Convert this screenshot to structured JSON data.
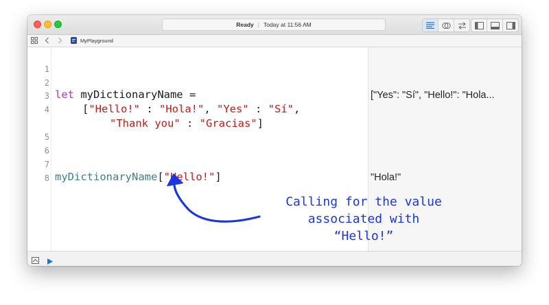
{
  "titlebar": {
    "status_label": "Ready",
    "timestamp": "Today at 11:56 AM"
  },
  "jumpbar": {
    "file_name": "MyPlayground"
  },
  "editor": {
    "line_numbers": [
      "1",
      "2",
      "3",
      "4",
      "5",
      "6",
      "7",
      "8"
    ],
    "line3": {
      "keyword": "let",
      "rest": " myDictionaryName ="
    },
    "line4a": {
      "open": "[",
      "k1": "\"Hello!\"",
      "sep1": " : ",
      "v1": "\"Hola!\"",
      "comma1": ", ",
      "k2": "\"Yes\"",
      "sep2": " : ",
      "v2": "\"Sí\"",
      "comma2": ","
    },
    "line4b": {
      "k3": "\"Thank you\"",
      "sep3": " : ",
      "v3": "\"Gracias\"",
      "close": "]"
    },
    "line8": {
      "ident": "myDictionaryName",
      "open": "[",
      "key": "\"Hello!\"",
      "close": "]"
    }
  },
  "results": {
    "line3": "[\"Yes\": \"Sí\", \"Hello!\": \"Hola...",
    "line8": "\"Hola!\""
  },
  "annotation": {
    "line1": "Calling for the value",
    "line2": "associated with",
    "line3": "“Hello!”",
    "color": "#1b36e0"
  },
  "colors": {
    "keyword": "#ad3da4",
    "string": "#c41a16",
    "identifier": "#3e8087",
    "run_button": "#1a73e8"
  }
}
